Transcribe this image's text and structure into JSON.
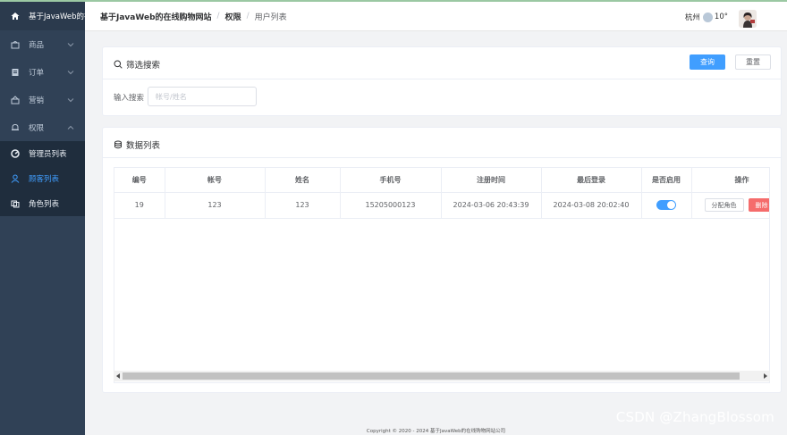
{
  "sidebar": {
    "brand": "基于JavaWeb的在",
    "menu": [
      {
        "label": "商品",
        "icon": "shop-icon"
      },
      {
        "label": "订单",
        "icon": "order-icon"
      },
      {
        "label": "营销",
        "icon": "marketing-icon"
      },
      {
        "label": "权限",
        "icon": "bell-icon"
      }
    ],
    "submenu": [
      {
        "label": "管理员列表",
        "icon": "admin-icon"
      },
      {
        "label": "顾客列表",
        "icon": "user-icon"
      },
      {
        "label": "角色列表",
        "icon": "role-icon"
      }
    ],
    "active_color": "#409eff"
  },
  "header": {
    "breadcrumb": [
      "基于JavaWeb的在线购物网站",
      "权限",
      "用户列表"
    ],
    "city": "杭州",
    "temperature": "10°"
  },
  "filter": {
    "title": "筛选搜索",
    "query_button": "查询",
    "reset_button": "重置",
    "search_label": "输入搜索",
    "search_placeholder": "帐号/姓名",
    "search_value": ""
  },
  "table": {
    "title": "数据列表",
    "columns": [
      "编号",
      "帐号",
      "姓名",
      "手机号",
      "注册时间",
      "最后登录",
      "是否启用",
      "操作"
    ],
    "rows": [
      {
        "id": "19",
        "account": "123",
        "name": "123",
        "phone": "15205000123",
        "register_time": "2024-03-06 20:43:39",
        "last_login": "2024-03-08 20:02:40",
        "enabled": true,
        "assign_label": "分配角色",
        "delete_label": "删除"
      }
    ]
  },
  "footer": "Copyright © 2020 - 2024   基于JavaWeb的在线购物网站公司",
  "watermark": "CSDN @ZhangBlossom"
}
